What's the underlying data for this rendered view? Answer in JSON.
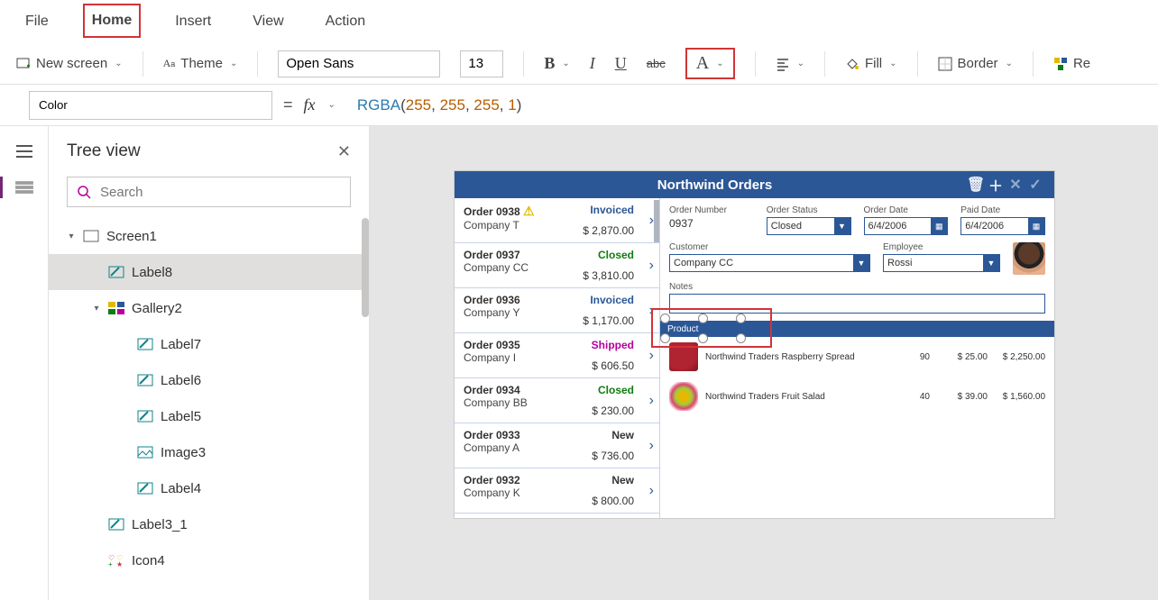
{
  "menu": {
    "file": "File",
    "home": "Home",
    "insert": "Insert",
    "view": "View",
    "action": "Action"
  },
  "ribbon": {
    "new_screen": "New screen",
    "theme": "Theme",
    "font_name": "Open Sans",
    "font_size": "13",
    "fill": "Fill",
    "border": "Border",
    "re": "Re"
  },
  "formula": {
    "property": "Color",
    "fx": "fx",
    "fn": "RGBA",
    "args": [
      "255",
      "255",
      "255",
      "1"
    ]
  },
  "tree": {
    "title": "Tree view",
    "search_placeholder": "Search",
    "items": [
      {
        "depth": 0,
        "icon": "screen",
        "label": "Screen1",
        "twist": "▾"
      },
      {
        "depth": 1,
        "icon": "label",
        "label": "Label8",
        "selected": true
      },
      {
        "depth": 1,
        "icon": "gallery",
        "label": "Gallery2",
        "twist": "▾"
      },
      {
        "depth": 2,
        "icon": "label",
        "label": "Label7"
      },
      {
        "depth": 2,
        "icon": "label",
        "label": "Label6"
      },
      {
        "depth": 2,
        "icon": "label",
        "label": "Label5"
      },
      {
        "depth": 2,
        "icon": "image",
        "label": "Image3"
      },
      {
        "depth": 2,
        "icon": "label",
        "label": "Label4"
      },
      {
        "depth": 1,
        "icon": "label",
        "label": "Label3_1"
      },
      {
        "depth": 1,
        "icon": "icons",
        "label": "Icon4"
      }
    ]
  },
  "app": {
    "title": "Northwind Orders",
    "orders": [
      {
        "num": "Order 0938",
        "company": "Company T",
        "status": "Invoiced",
        "amount": "$ 2,870.00",
        "warn": true
      },
      {
        "num": "Order 0937",
        "company": "Company CC",
        "status": "Closed",
        "amount": "$ 3,810.00"
      },
      {
        "num": "Order 0936",
        "company": "Company Y",
        "status": "Invoiced",
        "amount": "$ 1,170.00"
      },
      {
        "num": "Order 0935",
        "company": "Company I",
        "status": "Shipped",
        "amount": "$ 606.50"
      },
      {
        "num": "Order 0934",
        "company": "Company BB",
        "status": "Closed",
        "amount": "$ 230.00"
      },
      {
        "num": "Order 0933",
        "company": "Company A",
        "status": "New",
        "amount": "$ 736.00"
      },
      {
        "num": "Order 0932",
        "company": "Company K",
        "status": "New",
        "amount": "$ 800.00"
      }
    ],
    "detail": {
      "labels": {
        "order_number": "Order Number",
        "order_status": "Order Status",
        "order_date": "Order Date",
        "paid_date": "Paid Date",
        "customer": "Customer",
        "employee": "Employee",
        "notes": "Notes",
        "product": "Product"
      },
      "order_number": "0937",
      "order_status": "Closed",
      "order_date": "6/4/2006",
      "paid_date": "6/4/2006",
      "customer": "Company CC",
      "employee": "Rossi",
      "products": [
        {
          "name": "Northwind Traders Raspberry Spread",
          "qty": "90",
          "price": "$ 25.00",
          "total": "$ 2,250.00",
          "img": "a"
        },
        {
          "name": "Northwind Traders Fruit Salad",
          "qty": "40",
          "price": "$ 39.00",
          "total": "$ 1,560.00",
          "img": "b"
        }
      ]
    }
  }
}
